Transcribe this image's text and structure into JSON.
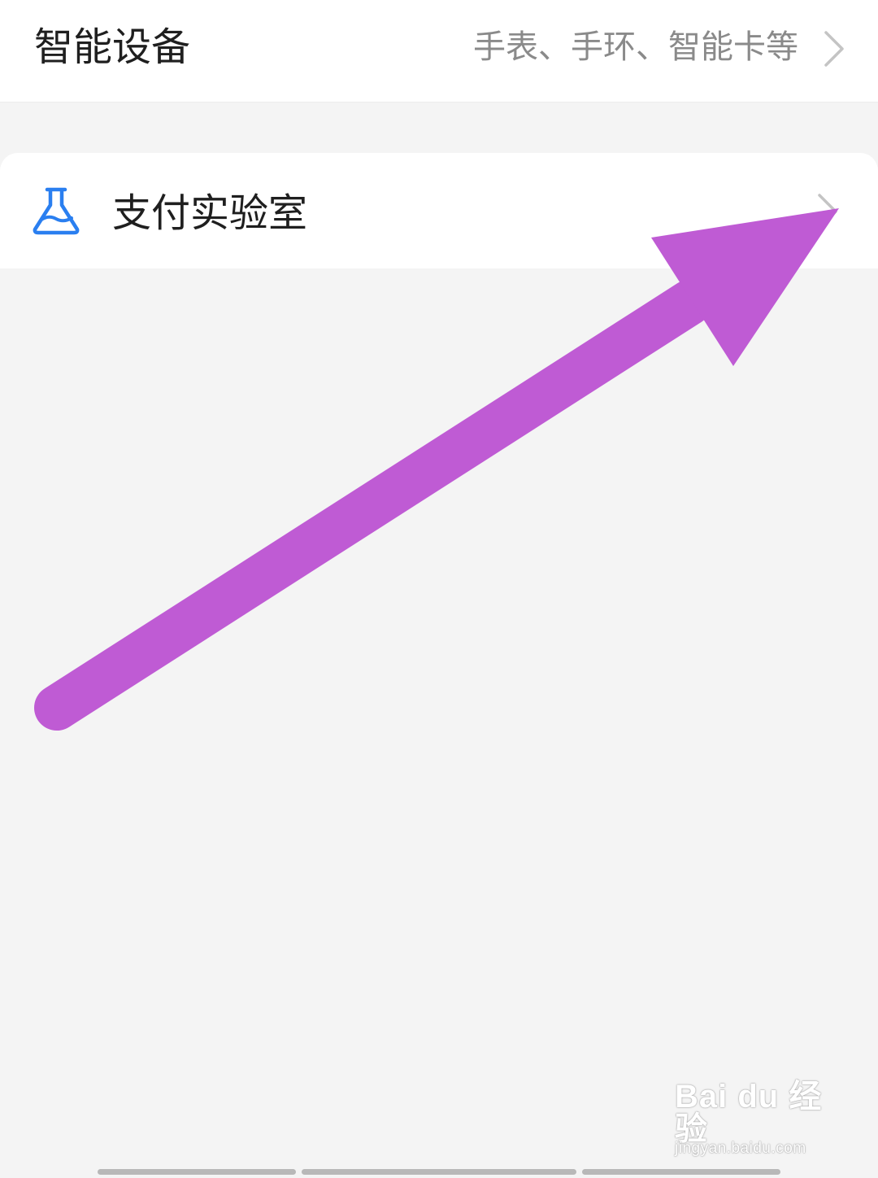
{
  "smart_devices": {
    "title": "智能设备",
    "subtitle": "手表、手环、智能卡等",
    "chevron_icon": "chevron-right-icon"
  },
  "pay_lab": {
    "title": "支付实验室",
    "icon": "flask-icon",
    "icon_color": "#2a7ff0",
    "chevron_icon": "chevron-right-icon"
  },
  "annotation": {
    "icon": "arrow-annotation",
    "color": "#bf5bd4"
  },
  "watermark": {
    "logo": "Bai du 经验",
    "url": "jingyan.baidu.com"
  },
  "colors": {
    "background": "#f4f4f4",
    "card": "#ffffff",
    "title_text": "#1f1f1f",
    "subtitle_text": "#8a8a8a"
  }
}
